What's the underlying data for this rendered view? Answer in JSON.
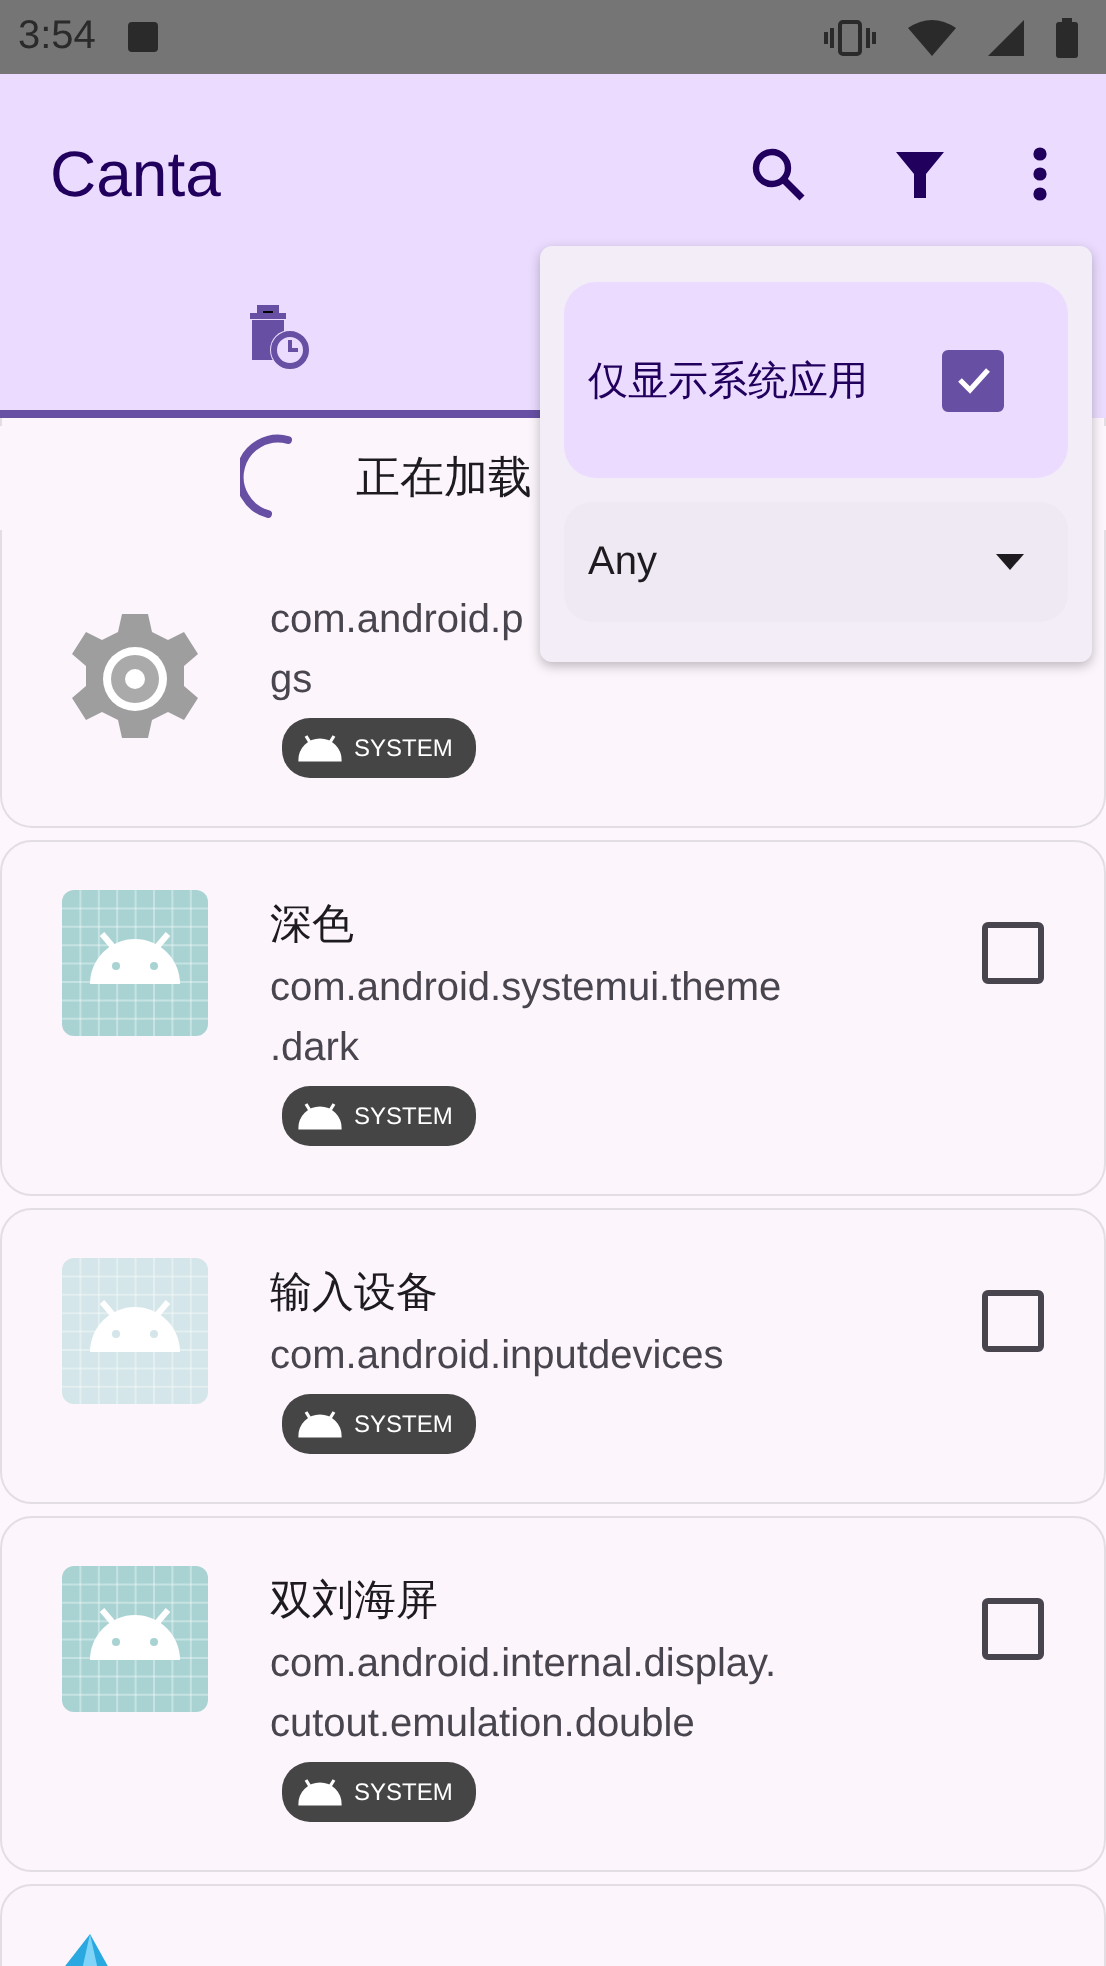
{
  "status_bar": {
    "time": "3:54"
  },
  "app_bar": {
    "title": "Canta"
  },
  "tabs": [
    {
      "selected": true
    }
  ],
  "loading": {
    "text": "正在加载"
  },
  "apps": [
    {
      "kind": "gear",
      "package_lines": [
        "com.android.p",
        "gs"
      ],
      "badge": "SYSTEM"
    },
    {
      "kind": "android",
      "title": "深色",
      "package_lines": [
        "com.android.systemui.theme",
        ".dark"
      ],
      "badge": "SYSTEM",
      "checked": false
    },
    {
      "kind": "android_light",
      "title": "输入设备",
      "package_lines": [
        "com.android.inputdevices"
      ],
      "badge": "SYSTEM",
      "checked": false
    },
    {
      "kind": "android",
      "title": "双刘海屏",
      "package_lines": [
        "com.android.internal.display.",
        "cutout.emulation.double"
      ],
      "badge": "SYSTEM",
      "checked": false
    },
    {
      "kind": "gem"
    }
  ],
  "filter_menu": {
    "option": {
      "label": "仅显示系统应用",
      "checked": true
    },
    "dropdown": {
      "value": "Any"
    }
  }
}
